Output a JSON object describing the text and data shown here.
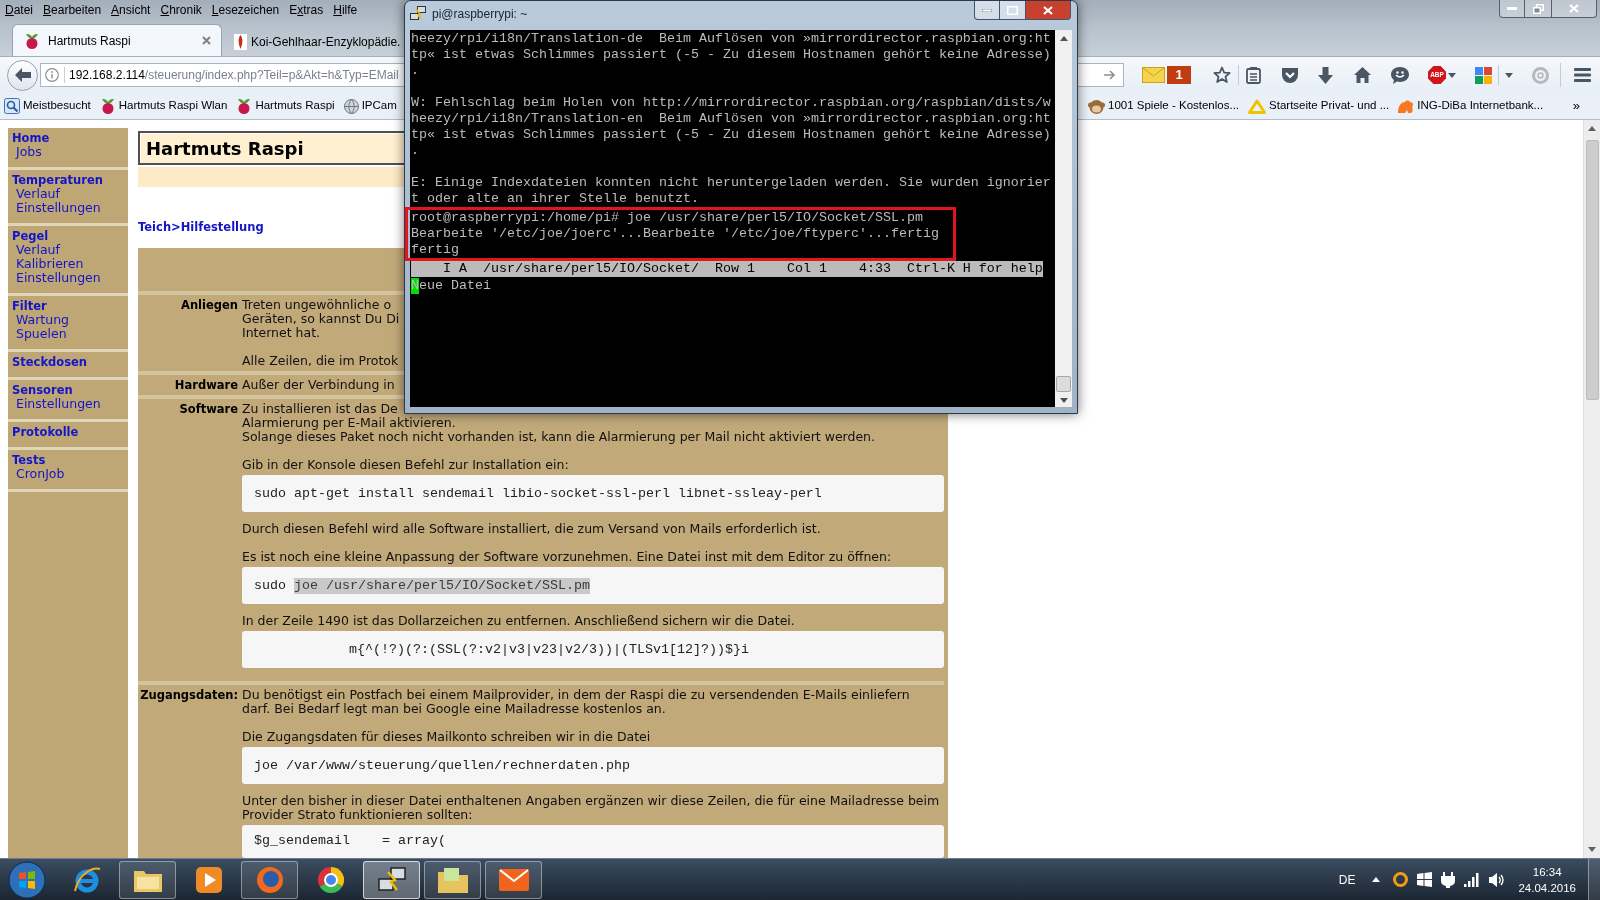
{
  "browser": {
    "menu": [
      {
        "key": "D",
        "rest": "atei"
      },
      {
        "key": "B",
        "rest": "earbeiten"
      },
      {
        "key": "A",
        "rest": "nsicht"
      },
      {
        "key": "C",
        "rest": "hronik"
      },
      {
        "key": "L",
        "rest": "esezeichen"
      },
      {
        "lead": "E",
        "key": "x",
        "rest": "tras"
      },
      {
        "key": "H",
        "rest": "ilfe"
      }
    ],
    "tabs": [
      {
        "title": "Hartmuts Raspi",
        "selected": true
      },
      {
        "title": "Koi-Gehlhaar-Enzyklopädie.",
        "selected": false
      }
    ],
    "address": {
      "host": "192.168.2.114",
      "path": "/steuerung/index.php?Teil=p&Akt=h&Typ=EMail"
    },
    "mail_count": "1",
    "adblock_label": "ABP",
    "bookmarks": {
      "left": [
        {
          "label": "Meistbesucht"
        },
        {
          "label": "Hartmuts Raspi Wlan"
        },
        {
          "label": "Hartmuts Raspi"
        },
        {
          "label": "IPCam"
        }
      ],
      "right": [
        {
          "label": "1001 Spiele - Kostenlos..."
        },
        {
          "label": "Startseite Privat- und ..."
        },
        {
          "label": "ING-DiBa Internetbank..."
        }
      ],
      "overflow": "»"
    }
  },
  "terminal": {
    "title": "pi@raspberrypi: ~",
    "output": [
      {
        "kind": "text",
        "text": "heezy/rpi/i18n/Translation-de  Beim Auflösen von »mirrordirector.raspbian.org:ht"
      },
      {
        "kind": "text",
        "text": "tp« ist etwas Schlimmes passiert (-5 - Zu diesem Hostnamen gehört keine Adresse)"
      },
      {
        "kind": "text",
        "text": "."
      },
      {
        "kind": "blank"
      },
      {
        "kind": "text",
        "text": "W: Fehlschlag beim Holen von http://mirrordirector.raspbian.org/raspbian/dists/w"
      },
      {
        "kind": "text",
        "text": "heezy/rpi/i18n/Translation-en  Beim Auflösen von »mirrordirector.raspbian.org:ht"
      },
      {
        "kind": "text",
        "text": "tp« ist etwas Schlimmes passiert (-5 - Zu diesem Hostnamen gehört keine Adresse)"
      },
      {
        "kind": "text",
        "text": "."
      },
      {
        "kind": "blank"
      },
      {
        "kind": "text",
        "text": "E: Einige Indexdateien konnten nicht heruntergeladen werden. Sie wurden ignorier"
      },
      {
        "kind": "text",
        "text": "t oder alte an ihrer Stelle benutzt."
      }
    ],
    "marked_lines": [
      "root@raspberrypi:/home/pi# joe /usr/share/perl5/IO/Socket/SSL.pm",
      "Bearbeite '/etc/joe/joerc'...Bearbeite '/etc/joe/ftyperc'...fertig",
      "fertig"
    ],
    "status_line": "    I A  /usr/share/perl5/IO/Socket/  Row 1    Col 1    4:33  Ctrl-K H for help",
    "editor_lines": [
      {
        "text": "Neue Datei",
        "cursor": true
      }
    ]
  },
  "page": {
    "sidebar": [
      {
        "heading": "Home",
        "items": [
          "Jobs"
        ]
      },
      {
        "heading": "Temperaturen",
        "items": [
          "Verlauf",
          "Einstellungen"
        ]
      },
      {
        "heading": "Pegel",
        "items": [
          "Verlauf",
          "Kalibrieren",
          "Einstellungen"
        ]
      },
      {
        "heading": "Filter",
        "items": [
          "Wartung",
          "Spuelen"
        ]
      },
      {
        "heading": "Steckdosen"
      },
      {
        "heading": "Sensoren",
        "items": [
          "Einstellungen"
        ]
      },
      {
        "heading": "Protokolle"
      },
      {
        "heading": "Tests",
        "items": [
          "CronJob"
        ]
      }
    ],
    "site_title": "Hartmuts Raspi",
    "breadcrumb": {
      "links": [
        "Teich",
        "Hilfestellung"
      ],
      "separator": ">"
    },
    "sections": [
      {
        "label": "Anliegen",
        "blocks": [
          {
            "kind": "fragments",
            "lines": [
              "Treten ungewöhnliche o",
              "Geräten, so kannst Du Di",
              "Internet hat."
            ]
          },
          {
            "kind": "fragments",
            "lines": [
              "Alle Zeilen, die im Protok"
            ]
          }
        ]
      },
      {
        "label": "Hardware",
        "blocks": [
          {
            "kind": "fragments",
            "lines": [
              "Außer der Verbindung in"
            ]
          }
        ]
      },
      {
        "label": "Software",
        "blocks": [
          {
            "kind": "fragments",
            "lines": [
              "Zu installieren ist das De",
              "Alarmierung per E-Mail aktivieren.",
              "Solange dieses Paket noch nicht vorhanden ist, kann die Alarmierung per Mail nicht aktiviert werden."
            ]
          },
          {
            "kind": "paragraph",
            "lines": [
              "Gib in der Konsole diesen Befehl zur Installation ein:"
            ]
          },
          {
            "kind": "code",
            "indent": false,
            "segments": [
              {
                "text": "sudo apt-get install sendemail libio-socket-ssl-perl libnet-ssleay-perl",
                "selected": false
              }
            ]
          },
          {
            "kind": "paragraph",
            "lines": [
              "Durch diesen Befehl wird alle Software installiert, die zum Versand von Mails erforderlich ist."
            ]
          },
          {
            "kind": "paragraph",
            "lines": [
              "Es ist noch eine kleine Anpassung der Software vorzunehmen. Eine Datei inst mit dem Editor zu öffnen:"
            ]
          },
          {
            "kind": "code",
            "indent": false,
            "segments": [
              {
                "text": "sudo",
                "selected": false
              },
              {
                "text": "joe /usr/share/perl5/IO/Socket/SSL.pm",
                "selected": true
              }
            ]
          },
          {
            "kind": "paragraph",
            "lines": [
              "In der Zeile 1490 ist das Dollarzeichen zu entfernen. Anschließend sichern wir die Datei."
            ]
          },
          {
            "kind": "code",
            "indent": true,
            "segments": [
              {
                "text": "m{^(!?)(?:(SSL(?:v2|v3|v23|v2/3))|(TLSv1[12]?))$}i",
                "selected": false
              }
            ]
          }
        ]
      },
      {
        "label": "Zugangsdaten:",
        "blocks": [
          {
            "kind": "paragraph",
            "lines": [
              "Du benötigst ein Postfach bei einem Mailprovider, in dem der Raspi die zu versendenden E-Mails einliefern",
              "darf. Bei Bedarf legt man bei Google eine Mailadresse kostenlos an."
            ]
          },
          {
            "kind": "paragraph",
            "lines": [
              "Die Zugangsdaten für dieses Mailkonto schreiben wir in die Datei"
            ]
          },
          {
            "kind": "code",
            "indent": false,
            "segments": [
              {
                "text": "joe /var/www/steuerung/quellen/rechnerdaten.php",
                "selected": false
              }
            ]
          },
          {
            "kind": "paragraph",
            "lines": [
              "Unter den bisher in dieser Datei enthaltenen Angaben ergänzen wir diese Zeilen, die für eine Mailadresse beim",
              "Provider Strato funktionieren sollten:"
            ]
          },
          {
            "kind": "code",
            "indent": false,
            "segments": [
              {
                "text": "$g_sendemail    = array(",
                "selected": false
              }
            ]
          }
        ]
      }
    ]
  },
  "taskbar": {
    "apps": [
      {
        "kind": "e-swoosh",
        "running": false,
        "active": false
      },
      {
        "kind": "folder",
        "running": true,
        "active": false
      },
      {
        "kind": "play",
        "running": false,
        "active": false
      },
      {
        "kind": "ringed-disc",
        "running": true,
        "active": false
      },
      {
        "kind": "segmented-circle",
        "running": false,
        "active": false
      },
      {
        "kind": "computers",
        "running": true,
        "active": true
      },
      {
        "kind": "folder-note",
        "running": true,
        "active": false
      },
      {
        "kind": "envelope",
        "running": true,
        "active": false
      }
    ],
    "language": "DE",
    "time": "16:34",
    "date": "24.04.2016"
  }
}
